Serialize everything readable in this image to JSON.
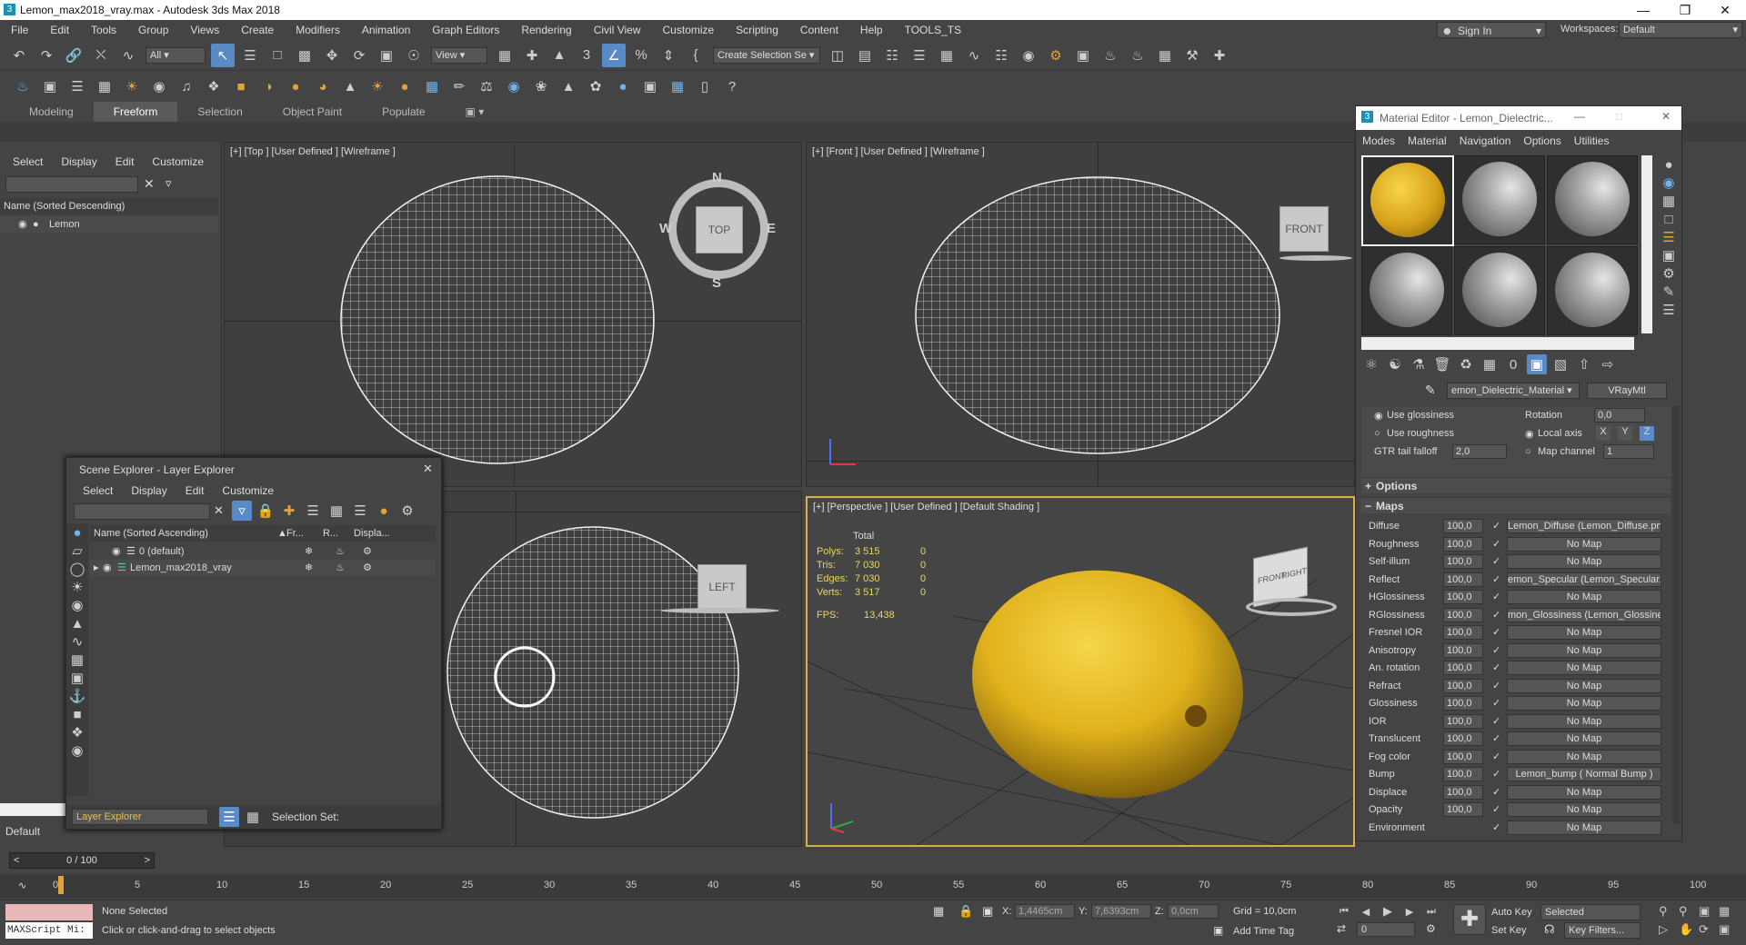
{
  "window": {
    "title": "Lemon_max2018_vray.max - Autodesk 3ds Max 2018",
    "app_icon": "3"
  },
  "menubar": {
    "items": [
      "File",
      "Edit",
      "Tools",
      "Group",
      "Views",
      "Create",
      "Modifiers",
      "Animation",
      "Graph Editors",
      "Rendering",
      "Civil View",
      "Customize",
      "Scripting",
      "Content",
      "Help",
      "TOOLS_TS"
    ],
    "sign_in": "Sign In",
    "workspaces_label": "Workspaces:",
    "workspace_value": "Default"
  },
  "toolbar": {
    "selection_filter": "All",
    "reference_coord": "View",
    "create_selection_set": "Create Selection Se"
  },
  "ribbon": {
    "tabs": [
      "Modeling",
      "Freeform",
      "Selection",
      "Object Paint",
      "Populate"
    ],
    "active": "Freeform"
  },
  "left_panel": {
    "menus": [
      "Select",
      "Display",
      "Edit",
      "Customize"
    ],
    "column_header": "Name (Sorted Descending)",
    "items": [
      "Lemon"
    ],
    "footer_label": "Default"
  },
  "viewports": {
    "top": {
      "label": "[+] [Top ] [User Defined ] [Wireframe ]",
      "cube": "TOP",
      "compass": {
        "n": "N",
        "s": "S",
        "e": "E",
        "w": "W"
      }
    },
    "front": {
      "label": "[+] [Front ] [User Defined ] [Wireframe ]",
      "cube": "FRONT"
    },
    "left": {
      "cube": "LEFT"
    },
    "perspective": {
      "label": "[+] [Perspective ] [User Defined ] [Default Shading ]",
      "cube_front": "FRONT",
      "cube_right": "RIGHT",
      "stats": {
        "header": "Total",
        "rows": [
          {
            "label": "Polys:",
            "total": "3 515",
            "sel": "0"
          },
          {
            "label": "Tris:",
            "total": "7 030",
            "sel": "0"
          },
          {
            "label": "Edges:",
            "total": "7 030",
            "sel": "0"
          },
          {
            "label": "Verts:",
            "total": "3 517",
            "sel": "0"
          }
        ],
        "fps_label": "FPS:",
        "fps_value": "13,438"
      }
    }
  },
  "scene_explorer": {
    "title": "Scene Explorer - Layer Explorer",
    "menus": [
      "Select",
      "Display",
      "Edit",
      "Customize"
    ],
    "columns": [
      "Name (Sorted Ascending)",
      "Fr...",
      "R...",
      "Displa..."
    ],
    "rows": [
      "0 (default)",
      "Lemon_max2018_vray"
    ],
    "footer_mode": "Layer Explorer",
    "selection_set_label": "Selection Set:"
  },
  "material_editor": {
    "title": "Material Editor - Lemon_Dielectric...",
    "menus": [
      "Modes",
      "Material",
      "Navigation",
      "Options",
      "Utilities"
    ],
    "material_name": "emon_Dielectric_Material",
    "material_type": "VRayMtl",
    "options_top": {
      "use_glossiness": "Use glossiness",
      "use_roughness": "Use roughness",
      "gtr_tail_label": "GTR tail falloff",
      "gtr_tail_value": "2,0",
      "rotation_label": "Rotation",
      "rotation_value": "0,0",
      "local_axis": "Local axis",
      "axes": [
        "X",
        "Y",
        "Z"
      ],
      "map_channel_label": "Map channel",
      "map_channel_value": "1"
    },
    "rollouts": {
      "options": "Options",
      "maps": "Maps"
    },
    "maps": [
      {
        "name": "Diffuse",
        "amount": "100,0",
        "map": "Lemon_Diffuse (Lemon_Diffuse.png)"
      },
      {
        "name": "Roughness",
        "amount": "100,0",
        "map": "No Map"
      },
      {
        "name": "Self-illum",
        "amount": "100,0",
        "map": "No Map"
      },
      {
        "name": "Reflect",
        "amount": "100,0",
        "map": "emon_Specular (Lemon_Specular.png"
      },
      {
        "name": "HGlossiness",
        "amount": "100,0",
        "map": "No Map"
      },
      {
        "name": "RGlossiness",
        "amount": "100,0",
        "map": "mon_Glossiness (Lemon_Glossiness.pr"
      },
      {
        "name": "Fresnel IOR",
        "amount": "100,0",
        "map": "No Map"
      },
      {
        "name": "Anisotropy",
        "amount": "100,0",
        "map": "No Map"
      },
      {
        "name": "An. rotation",
        "amount": "100,0",
        "map": "No Map"
      },
      {
        "name": "Refract",
        "amount": "100,0",
        "map": "No Map"
      },
      {
        "name": "Glossiness",
        "amount": "100,0",
        "map": "No Map"
      },
      {
        "name": "IOR",
        "amount": "100,0",
        "map": "No Map"
      },
      {
        "name": "Translucent",
        "amount": "100,0",
        "map": "No Map"
      },
      {
        "name": "Fog color",
        "amount": "100,0",
        "map": "No Map"
      },
      {
        "name": "Bump",
        "amount": "100,0",
        "map": "Lemon_bump ( Normal Bump )"
      },
      {
        "name": "Displace",
        "amount": "100,0",
        "map": "No Map"
      },
      {
        "name": "Opacity",
        "amount": "100,0",
        "map": "No Map"
      },
      {
        "name": "Environment",
        "amount": "",
        "map": "No Map"
      }
    ]
  },
  "timeline": {
    "frame_counter": "0 / 100",
    "ticks": [
      "0",
      "5",
      "10",
      "15",
      "20",
      "25",
      "30",
      "35",
      "40",
      "45",
      "50",
      "55",
      "60",
      "65",
      "70",
      "75",
      "80",
      "85",
      "90",
      "95",
      "100"
    ]
  },
  "status": {
    "maxscript": "MAXScript Mi:",
    "selection": "None Selected",
    "prompt": "Click or click-and-drag to select objects",
    "x_label": "X:",
    "x_value": "1,4465cm",
    "y_label": "Y:",
    "y_value": "7,6393cm",
    "z_label": "Z:",
    "z_value": "0,0cm",
    "grid": "Grid = 10,0cm",
    "add_time_tag": "Add Time Tag",
    "auto_key": "Auto Key",
    "set_key": "Set Key",
    "key_mode": "Selected",
    "key_filters": "Key Filters...",
    "frame_value": "0"
  },
  "colors": {
    "accent": "#5b8bc7",
    "lemon": "#e3b21f",
    "viewport_bg": "#3f3f3f",
    "active_border": "#d8b04a"
  }
}
